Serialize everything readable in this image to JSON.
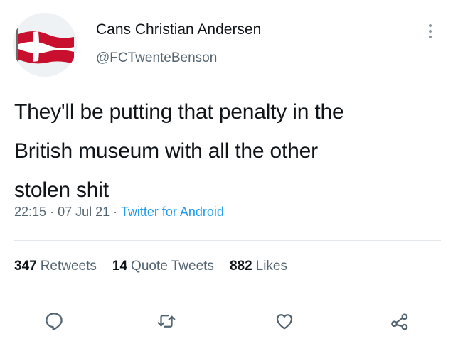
{
  "author": {
    "display_name": "Cans Christian Andersen",
    "handle": "@FCTwenteBenson"
  },
  "tweet": {
    "text_lines": [
      "They'll be putting that penalty in the",
      "British museum with all the other",
      "stolen shit"
    ],
    "time": "22:15",
    "date": "07 Jul 21",
    "separator": "·",
    "source": "Twitter for Android"
  },
  "stats": {
    "retweets_count": "347",
    "retweets_label": "Retweets",
    "quotes_count": "14",
    "quotes_label": "Quote Tweets",
    "likes_count": "882",
    "likes_label": "Likes"
  },
  "actions": [
    "reply-icon",
    "retweet-icon",
    "like-icon",
    "share-icon"
  ],
  "colors": {
    "text": "#0f1419",
    "secondary": "#536471",
    "accent": "#1d9bf0",
    "divider": "#e3e8ec",
    "flag_red": "#c8102e",
    "icon": "#536471"
  }
}
